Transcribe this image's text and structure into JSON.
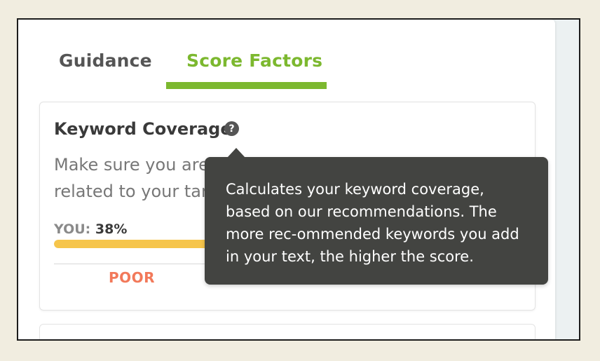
{
  "tabs": [
    {
      "label": "Guidance"
    },
    {
      "label": "Score Factors"
    }
  ],
  "active_tab": "Score Factors",
  "card": {
    "title": "Keyword Coverage",
    "description": "Make sure you are using keywords that are related to your target topic.",
    "description_visible_line1": "Make sure you are",
    "description_visible_line2": "related to your tar",
    "you_label": "YOU:",
    "you_value": "38%",
    "progress": 0.38,
    "status": "POOR"
  },
  "tooltip": {
    "text": "Calculates your keyword coverage, based on our recommendations. The more rec-ommended keywords you add in your text, the higher the score."
  },
  "colors": {
    "accent_green": "#7cb82f",
    "progress_yellow": "#f6c54b",
    "status_poor": "#f2795a",
    "tooltip_bg": "#434441"
  },
  "icons": {
    "help": "question-circle-icon"
  }
}
